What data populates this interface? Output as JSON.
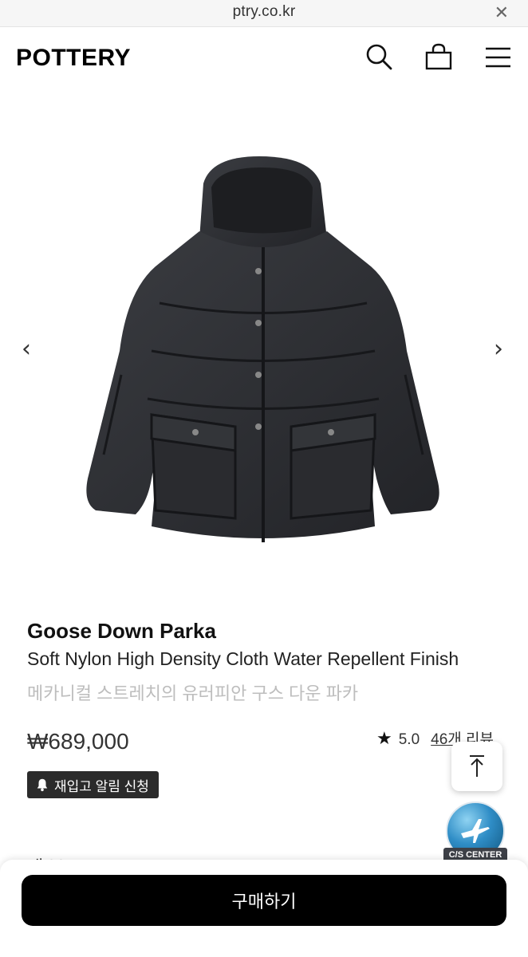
{
  "browser": {
    "url": "ptry.co.kr",
    "close_icon": "close-icon"
  },
  "header": {
    "logo": "POTTERY",
    "icons": [
      "search-icon",
      "shopping-bag-icon",
      "menu-icon"
    ]
  },
  "gallery": {
    "prev_arrow": "‹",
    "next_arrow": "›",
    "colors": {
      "jacket": "#2d2f33"
    }
  },
  "product": {
    "name": "Goose Down Parka",
    "subtitle": "Soft Nylon High Density Cloth Water Repellent Finish",
    "korean_name": "메카니컬 스트레치의 유러피안 구스 다운 파카",
    "price": "₩689,000",
    "rating_score": "5.0",
    "review_count": "46개 리뷰",
    "restock_label": "재입고 알림 신청"
  },
  "cs_center": {
    "label": "C/S CENTER"
  },
  "peek_text": "새 보 Storm ─ I N",
  "bottom": {
    "buy_label": "구매하기"
  }
}
